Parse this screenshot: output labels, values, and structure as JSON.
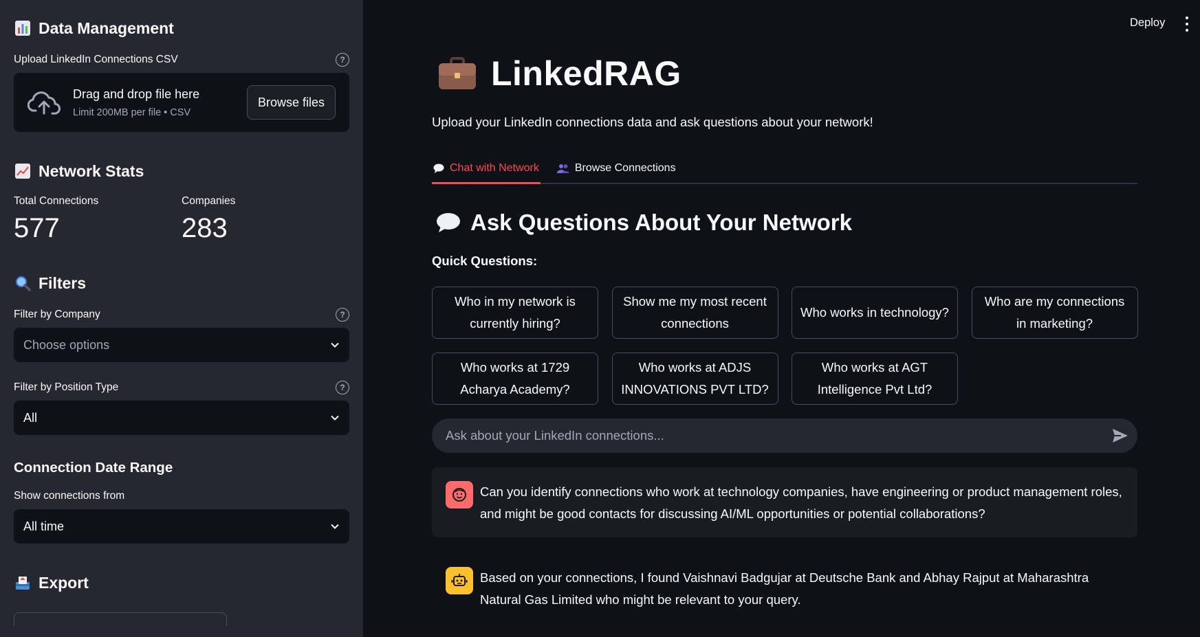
{
  "sidebar": {
    "data_management": {
      "title": "Data Management",
      "icon": "bar-chart-icon"
    },
    "upload": {
      "label": "Upload LinkedIn Connections CSV",
      "drag_text": "Drag and drop file here",
      "limit_text": "Limit 200MB per file • CSV",
      "browse_label": "Browse files"
    },
    "network_stats": {
      "title": "Network Stats",
      "icon": "trending-up-icon",
      "total_label": "Total Connections",
      "total_value": "577",
      "companies_label": "Companies",
      "companies_value": "283"
    },
    "filters": {
      "title": "Filters",
      "icon": "magnifier-icon",
      "company_label": "Filter by Company",
      "company_placeholder": "Choose options",
      "position_label": "Filter by Position Type",
      "position_value": "All"
    },
    "date_range": {
      "title": "Connection Date Range",
      "show_label": "Show connections from",
      "show_value": "All time"
    },
    "export": {
      "title": "Export",
      "icon": "outbox-icon"
    }
  },
  "header": {
    "deploy_label": "Deploy"
  },
  "main": {
    "title": "LinkedRAG",
    "title_icon": "briefcase-icon",
    "subtitle": "Upload your LinkedIn connections data and ask questions about your network!",
    "tabs": [
      {
        "label": "Chat with Network",
        "icon": "speech-bubble-icon",
        "active": true
      },
      {
        "label": "Browse Connections",
        "icon": "people-icon",
        "active": false
      }
    ],
    "section_title": "Ask Questions About Your Network",
    "quick_label": "Quick Questions:",
    "quick_questions": [
      "Who in my network is currently hiring?",
      "Show me my most recent connections",
      "Who works in technology?",
      "Who are my connections in marketing?",
      "Who works at 1729 Acharya Academy?",
      "Who works at ADJS INNOVATIONS PVT LTD?",
      "Who works at AGT Intelligence Pvt Ltd?"
    ],
    "chat_placeholder": "Ask about your LinkedIn connections...",
    "messages": [
      {
        "role": "user",
        "text": "Can you identify connections who work at technology companies, have engineering or product management roles, and might be good contacts for discussing AI/ML opportunities or potential collaborations?"
      },
      {
        "role": "assistant",
        "text": "Based on your connections, I found Vaishnavi Badgujar at Deutsche Bank and Abhay Rajput at Maharashtra Natural Gas Limited who might be relevant to your query."
      }
    ]
  },
  "colors": {
    "accent": "#ff4b4b",
    "sidebar_bg": "#262730",
    "main_bg": "#0e1117",
    "user_avatar": "#ff6b6b",
    "bot_avatar": "#fbc02d"
  }
}
